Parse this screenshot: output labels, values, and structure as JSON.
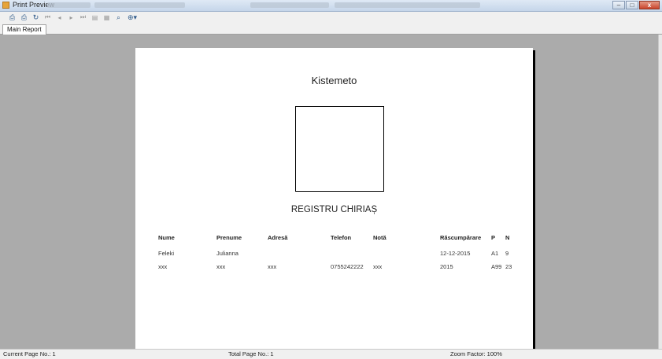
{
  "window": {
    "title": "Print Preview",
    "controls": {
      "minimize": "–",
      "maximize": "□",
      "close": "x"
    }
  },
  "toolbar": {
    "icons": [
      "print-setup-icon",
      "print-icon",
      "refresh-icon",
      "first-page-icon",
      "prev-page-icon",
      "next-page-icon",
      "last-page-icon",
      "export-icon",
      "group-tree-icon",
      "search-icon",
      "zoom-icon"
    ],
    "glyphs": {
      "print_setup": "⎙",
      "print": "⎙",
      "refresh": "↻",
      "first": "⏮",
      "prev": "◂",
      "next": "▸",
      "last": "⏭",
      "export": "▤",
      "group_tree": "▦",
      "search": "⌕",
      "zoom": "⊕▾"
    }
  },
  "tabs": [
    {
      "label": "Main Report"
    }
  ],
  "report": {
    "title": "Kistemeto",
    "subtitle": "REGISTRU CHIRIAȘ",
    "columns": [
      "Nume",
      "Prenume",
      "Adresă",
      "Telefon",
      "Notă",
      "Răscumpărare",
      "P",
      "N"
    ],
    "rows": [
      [
        "Feleki",
        "Julianna",
        "",
        "",
        "",
        "12-12-2015",
        "A1",
        "9"
      ],
      [
        "xxx",
        "xxx",
        "xxx",
        "0755242222",
        "xxx",
        "2015",
        "A99",
        "23"
      ]
    ]
  },
  "status": {
    "current_page": "Current Page No.: 1",
    "total_pages": "Total Page No.: 1",
    "zoom": "Zoom Factor: 100%"
  }
}
